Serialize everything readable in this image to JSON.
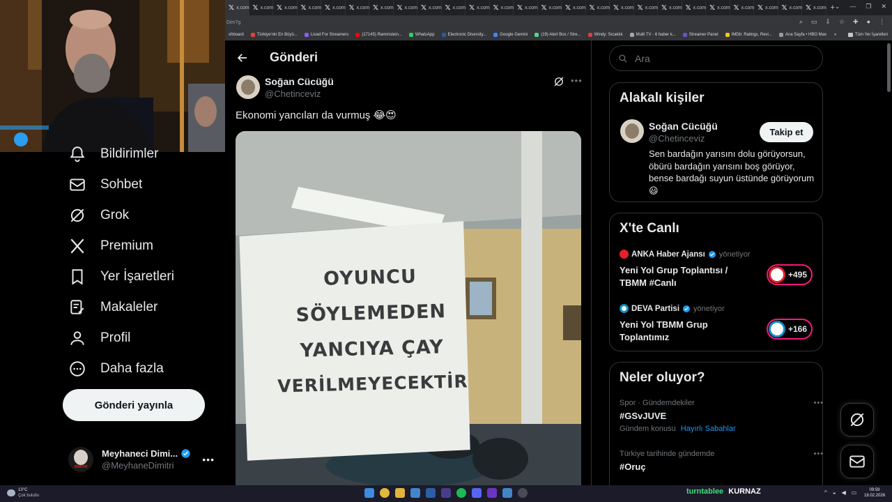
{
  "browser": {
    "tabs_label": "x.com",
    "url_fragment": "Dim7g",
    "bookmarks": [
      "shboard",
      "Türkiye'nin En Büyü...",
      "Livad For Streamers",
      "(17145) Rammstein...",
      "WhatsApp",
      "Electronic Diversity...",
      "Google Gemini",
      "(19) Alert Box / Stre...",
      "Windy: Sıcaklık",
      "Multi TV - 6 haber k...",
      "Streamer Panel",
      "IMDb: Ratings, Revi...",
      "Ana Sayfa • HBO Max"
    ],
    "bookmarks_more": "»",
    "all_bookmarks": "Tüm Yer İşaretleri"
  },
  "nav": {
    "items": [
      {
        "label": "Bildirimler"
      },
      {
        "label": "Sohbet"
      },
      {
        "label": "Grok"
      },
      {
        "label": "Premium"
      },
      {
        "label": "Yer İşaretleri"
      },
      {
        "label": "Makaleler"
      },
      {
        "label": "Profil"
      },
      {
        "label": "Daha fazla"
      }
    ],
    "post_button": "Gönderi yayınla",
    "account": {
      "name": "Meyhaneci Dimi...",
      "handle": "@MeyhaneDimitri",
      "avatar_text": "DİMİTRİ"
    }
  },
  "post": {
    "header": "Gönderi",
    "author_name": "Soğan Cücüğü",
    "author_handle": "@Chetinceviz",
    "text": "Ekonomi yancıları da vurmuş 😂😍",
    "sign_lines": [
      "OYUNCU",
      "SÖYLEMEDEN",
      "YANCIYA ÇAY",
      "VERİLMEYECEKTİR"
    ]
  },
  "search": {
    "placeholder": "Ara"
  },
  "related": {
    "title": "Alakalı kişiler",
    "name": "Soğan Cücüğü",
    "handle": "@Chetinceviz",
    "follow": "Takip et",
    "bio": "Sen bardağın yarısını dolu görüyorsun, öbürü bardağın yarısını boş görüyor, bense bardağı suyun üstünde görüyorum 😃"
  },
  "live": {
    "title": "X'te Canlı",
    "items": [
      {
        "host": "ANKA Haber Ajansı",
        "role": "yönetiyor",
        "title": "Yeni Yol Grup Toplantısı / TBMM #Canlı",
        "count": "+495"
      },
      {
        "host": "DEVA Partisi",
        "role": "yönetiyor",
        "title": "Yeni Yol TBMM Grup Toplantımız",
        "count": "+166"
      }
    ]
  },
  "trends": {
    "title": "Neler oluyor?",
    "items": [
      {
        "context": "Spor · Gündemdekiler",
        "tag": "#GSvJUVE",
        "meta": "Gündem konusu",
        "link": "Hayırlı Sabahlar"
      },
      {
        "context": "Türkiye tarihinde gündemde",
        "tag": "#Oruç"
      }
    ]
  },
  "taskbar": {
    "weather_temp": "13°C",
    "weather_desc": "Çok bulutlu",
    "tray_text": "turntablee",
    "tray_bold": "KURNAZ",
    "time": "09:59",
    "date": "18.02.2026"
  },
  "colors": {
    "accent": "#1d9bf0",
    "post_button_bg": "#eff3f4",
    "live_ring": "#f91880"
  }
}
